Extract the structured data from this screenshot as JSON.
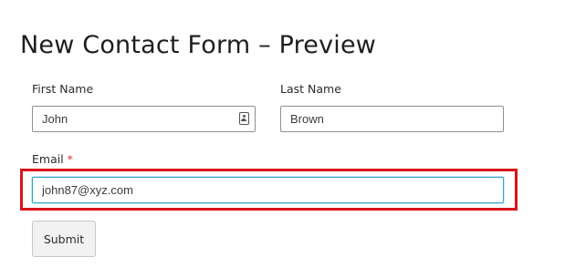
{
  "page": {
    "title": "New Contact Form – Preview"
  },
  "form": {
    "first_name": {
      "label": "First Name",
      "value": "John",
      "icon": "contact-card-icon"
    },
    "last_name": {
      "label": "Last Name",
      "value": "Brown"
    },
    "email": {
      "label": "Email",
      "required_marker": "*",
      "value": "john87@xyz.com",
      "focused": true
    },
    "submit_label": "Submit"
  },
  "colors": {
    "title": "#1e1e1e",
    "input_border": "#8c8f94",
    "focus_border": "#2ea2cc",
    "required": "#d63638",
    "highlight": "#d9141b",
    "button_bg": "#f2f2f2"
  }
}
